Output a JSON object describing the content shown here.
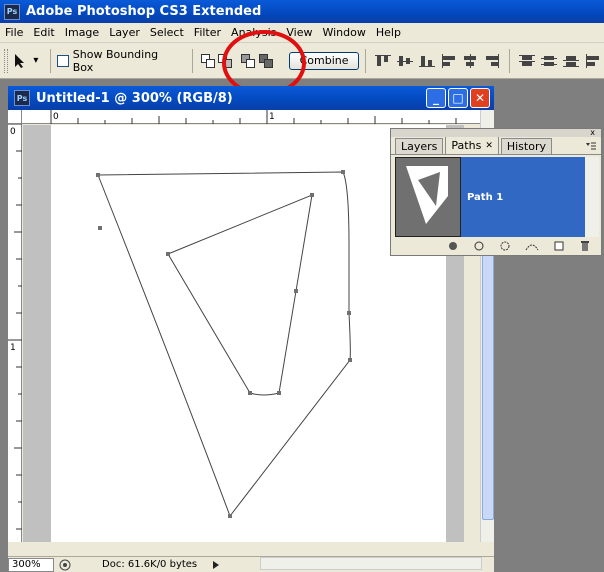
{
  "app": {
    "title": "Adobe Photoshop CS3 Extended",
    "logo": "Ps"
  },
  "menu": [
    "File",
    "Edit",
    "Image",
    "Layer",
    "Select",
    "Filter",
    "Analysis",
    "View",
    "Window",
    "Help"
  ],
  "options": {
    "show_bounding_box": "Show Bounding Box",
    "combine": "Combine",
    "dropdown_arrow": "▾"
  },
  "document": {
    "title": "Untitled-1 @ 300% (RGB/8)",
    "ruler_top_labels": [
      "0",
      "1"
    ],
    "ruler_left_labels": [
      "0",
      "1"
    ],
    "zoom": "300%",
    "doc_info": "Doc: 61.6K/0 bytes"
  },
  "window_buttons": {
    "minimize": "_",
    "maximize": "□",
    "close": "✕"
  },
  "panel": {
    "tabs": [
      {
        "label": "Layers"
      },
      {
        "label": "Paths",
        "close": "✕"
      },
      {
        "label": "History"
      }
    ],
    "close": "x",
    "path_item": "Path 1",
    "footer_icons": [
      "fill-path-icon",
      "stroke-path-icon",
      "load-selection-icon",
      "make-work-path-icon",
      "new-path-icon",
      "delete-path-icon"
    ]
  },
  "colors": {
    "title_bar": "#0348bd",
    "annotation": "#e01010",
    "selected_row": "#3168c4"
  }
}
